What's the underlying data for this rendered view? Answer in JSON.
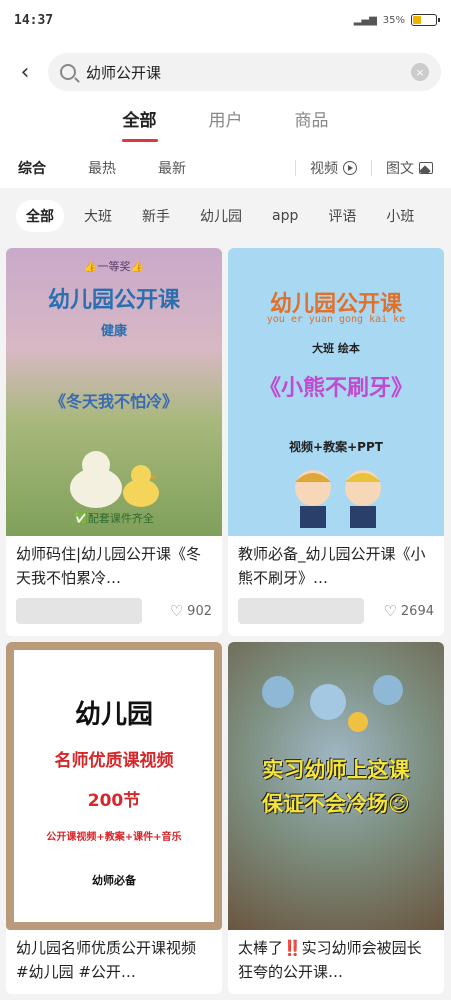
{
  "status_bar": {
    "time": "14:37",
    "battery": "35%",
    "battery_level": 0.35
  },
  "search": {
    "back_label": "‹",
    "query": "幼师公开课",
    "clear_label": "×"
  },
  "main_tabs": [
    {
      "label": "全部",
      "active": true
    },
    {
      "label": "用户",
      "active": false
    },
    {
      "label": "商品",
      "active": false
    }
  ],
  "sort": {
    "items": [
      "综合",
      "最热",
      "最新"
    ],
    "video_label": "视频",
    "image_text_label": "图文"
  },
  "chips": [
    "全部",
    "大班",
    "新手",
    "幼儿园",
    "app",
    "评语",
    "小班"
  ],
  "cards": [
    {
      "title": "幼师码住|幼儿园公开课《冬天我不怕累冷…",
      "likes": "902",
      "cover": {
        "badge": "👍一等奖👍",
        "heading": "幼儿园公开课",
        "sub": "健康",
        "lesson": "《冬天我不怕冷》",
        "footnote": "✅配套课件齐全",
        "bg": "#c7d59a"
      }
    },
    {
      "title": "教师必备_幼儿园公开课《小熊不刷牙》…",
      "likes": "2694",
      "cover": {
        "heading": "幼儿园公开课",
        "pinyin": "you er yuan gong kai ke",
        "sub": "大班 绘本",
        "lesson": "《小熊不刷牙》",
        "materials": "视频+教案+PPT",
        "bg": "#a9d8f2"
      }
    },
    {
      "title": "幼儿园名师优质公开课视频 #幼儿园 #公开…",
      "likes": "",
      "cover": {
        "heading": "幼儿园",
        "sub": "名师优质课视频",
        "count": "200节",
        "materials": "公开课视频+教案+课件+音乐",
        "footnote": "幼师必备",
        "bg": "#ffffff"
      }
    },
    {
      "title": "太棒了‼️实习幼师会被园长狂夸的公开课…",
      "likes": "",
      "cover": {
        "line1": "实习幼师上这课",
        "line2": "保证不会冷场😉",
        "bg": "#6f8a9a"
      }
    }
  ],
  "colors": {
    "accent": "#e0353f"
  }
}
